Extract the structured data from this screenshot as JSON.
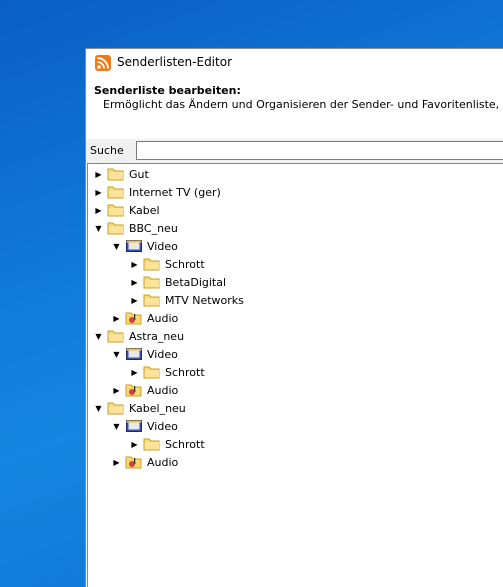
{
  "window": {
    "title": "Senderlisten-Editor"
  },
  "header": {
    "title": "Senderliste bearbeiten:",
    "description": "Ermöglicht das Ändern und Organisieren der Sender- und Favoritenliste, die"
  },
  "search": {
    "label": "Suche",
    "value": ""
  },
  "tree": [
    {
      "label": "Gut",
      "icon": "folder-icon",
      "expanded": false,
      "level": 0
    },
    {
      "label": "Internet TV (ger)",
      "icon": "folder-icon",
      "expanded": false,
      "level": 0
    },
    {
      "label": "Kabel",
      "icon": "folder-icon",
      "expanded": false,
      "level": 0
    },
    {
      "label": "BBC_neu",
      "icon": "folder-icon",
      "expanded": true,
      "level": 0
    },
    {
      "label": "Video",
      "icon": "video-icon",
      "expanded": true,
      "level": 1
    },
    {
      "label": "Schrott",
      "icon": "folder-icon",
      "expanded": false,
      "level": 2
    },
    {
      "label": "BetaDigital",
      "icon": "folder-icon",
      "expanded": false,
      "level": 2
    },
    {
      "label": "MTV Networks",
      "icon": "folder-icon",
      "expanded": false,
      "level": 2
    },
    {
      "label": "Audio",
      "icon": "audio-icon",
      "expanded": false,
      "level": 1
    },
    {
      "label": "Astra_neu",
      "icon": "folder-icon",
      "expanded": true,
      "level": 0
    },
    {
      "label": "Video",
      "icon": "video-icon",
      "expanded": true,
      "level": 1
    },
    {
      "label": "Schrott",
      "icon": "folder-icon",
      "expanded": false,
      "level": 2
    },
    {
      "label": "Audio",
      "icon": "audio-icon",
      "expanded": false,
      "level": 1
    },
    {
      "label": "Kabel_neu",
      "icon": "folder-icon",
      "expanded": true,
      "level": 0
    },
    {
      "label": "Video",
      "icon": "video-icon",
      "expanded": true,
      "level": 1
    },
    {
      "label": "Schrott",
      "icon": "folder-icon",
      "expanded": false,
      "level": 2
    },
    {
      "label": "Audio",
      "icon": "audio-icon",
      "expanded": false,
      "level": 1
    }
  ]
}
